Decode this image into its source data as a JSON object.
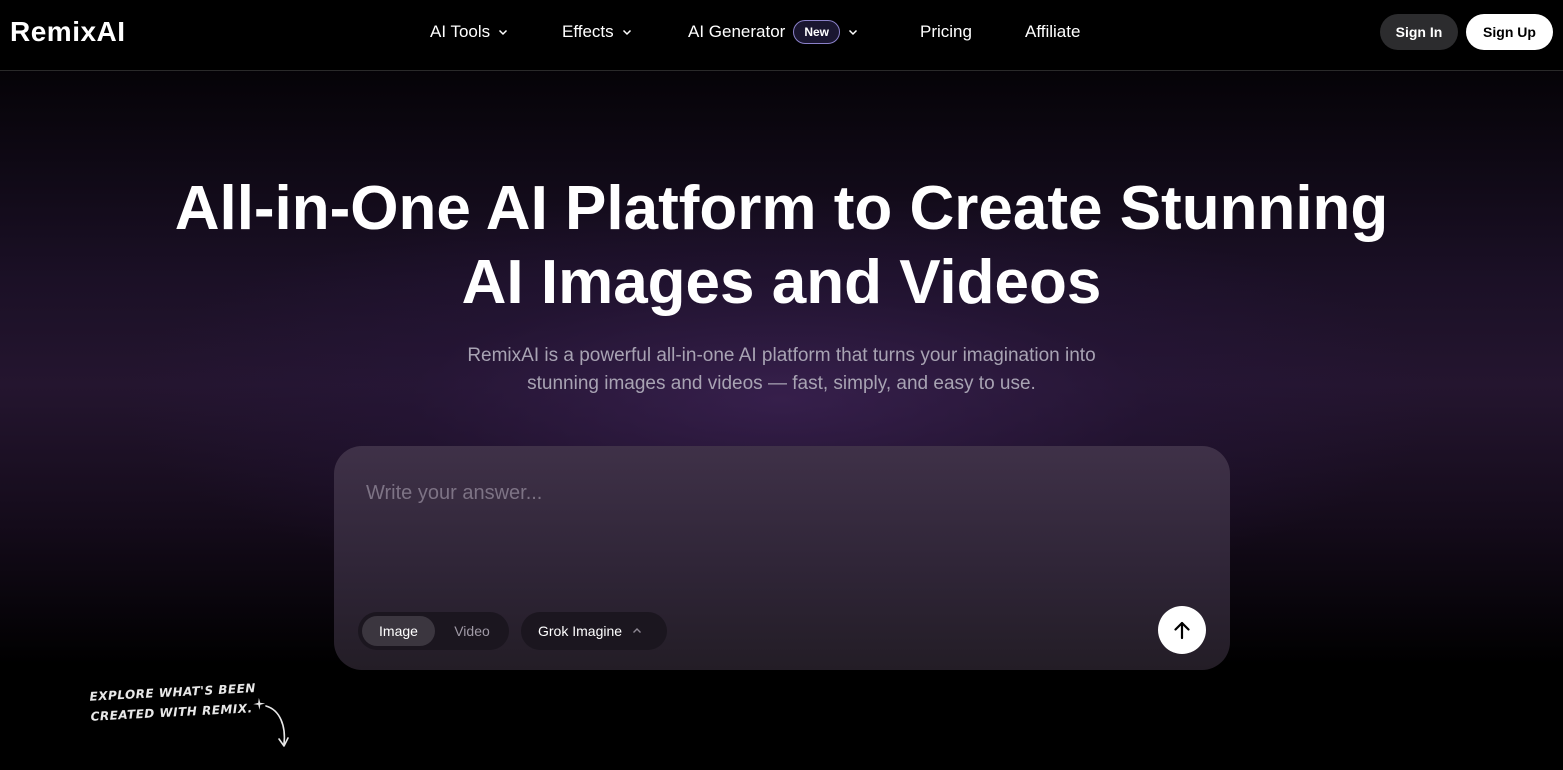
{
  "header": {
    "logo": "RemixAI",
    "nav": [
      {
        "label": "AI Tools",
        "has_dropdown": true
      },
      {
        "label": "Effects",
        "has_dropdown": true
      },
      {
        "label": "AI Generator",
        "badge": "New",
        "has_dropdown": true
      },
      {
        "label": "Pricing"
      },
      {
        "label": "Affiliate"
      }
    ],
    "sign_in": "Sign In",
    "sign_up": "Sign Up"
  },
  "hero": {
    "title_line1": "All-in-One AI Platform to Create Stunning",
    "title_line2": "AI Images and Videos",
    "subtitle_line1": "RemixAI is a powerful all-in-one AI platform that turns your imagination into",
    "subtitle_line2": "stunning images and videos — fast, simply, and easy to use."
  },
  "prompt": {
    "placeholder": "Write your answer...",
    "value": "",
    "mode_options": [
      "Image",
      "Video"
    ],
    "selected_mode": "Image",
    "model": "Grok Imagine"
  },
  "explore": {
    "line1": "Explore what's been",
    "line2": "created with Remix."
  },
  "colors": {
    "background": "#000000",
    "accent_badge_border": "#8a80c8",
    "prompt_box": "#3a2d44"
  },
  "icons": [
    "chevron-down-icon",
    "chevron-up-icon",
    "arrow-up-icon",
    "sparkle-icon",
    "curved-arrow-icon"
  ]
}
